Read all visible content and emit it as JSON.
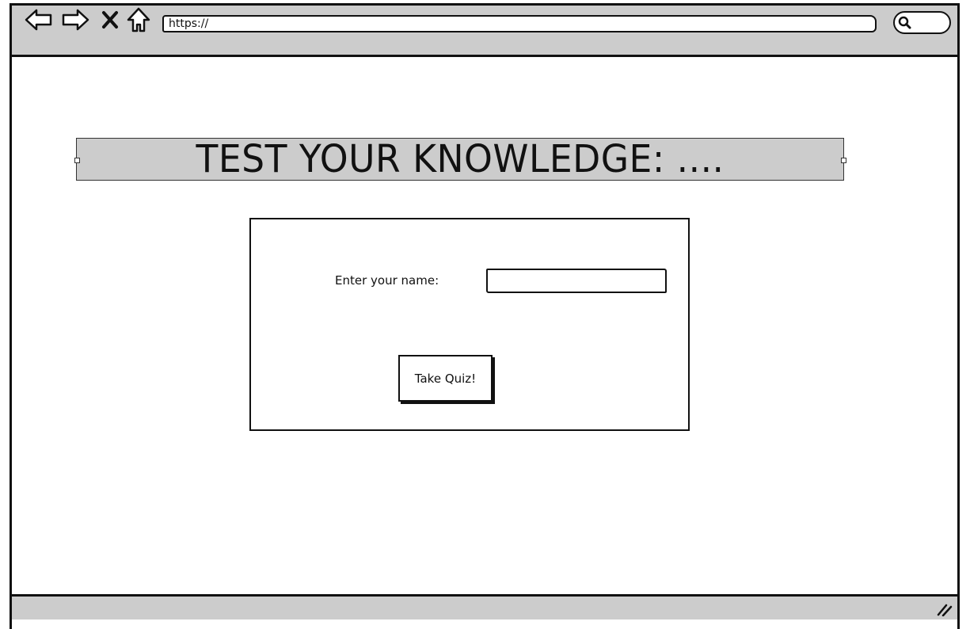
{
  "browser": {
    "url": "https://",
    "icons": {
      "back": "back-arrow-icon",
      "forward": "forward-arrow-icon",
      "stop": "close-icon",
      "home": "home-icon",
      "search": "search-icon",
      "resize": "resize-grip-icon"
    }
  },
  "page": {
    "title": "TEST YOUR KNOWLEDGE: ....",
    "form": {
      "name_label": "Enter your name:",
      "name_value": "",
      "submit_label": "Take Quiz!"
    }
  },
  "colors": {
    "chrome": "#cccccc",
    "ink": "#111111",
    "background": "#ffffff"
  }
}
